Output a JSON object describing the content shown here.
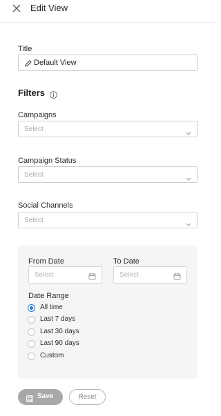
{
  "header": {
    "title": "Edit View",
    "close_icon": "close-icon"
  },
  "title_field": {
    "label": "Title",
    "value": "Default View",
    "icon": "pencil-icon"
  },
  "filters": {
    "heading": "Filters",
    "info_icon": "info-icon",
    "campaigns": {
      "label": "Campaigns",
      "placeholder": "Select"
    },
    "campaign_status": {
      "label": "Campaign Status",
      "placeholder": "Select"
    },
    "social_channels": {
      "label": "Social Channels",
      "placeholder": "Select"
    }
  },
  "date": {
    "from": {
      "label": "From Date",
      "placeholder": "Select"
    },
    "to": {
      "label": "To Date",
      "placeholder": "Select"
    },
    "range_label": "Date Range",
    "options": [
      {
        "label": "All time",
        "checked": true
      },
      {
        "label": "Last 7 days",
        "checked": false
      },
      {
        "label": "Last 30 days",
        "checked": false
      },
      {
        "label": "Last 90 days",
        "checked": false
      },
      {
        "label": "Custom",
        "checked": false
      }
    ]
  },
  "actions": {
    "save_label": "Save",
    "reset_label": "Reset"
  },
  "colors": {
    "accent": "#1976d2",
    "save_bg": "#a8a8a8",
    "panel_bg": "#f5f5f5"
  }
}
